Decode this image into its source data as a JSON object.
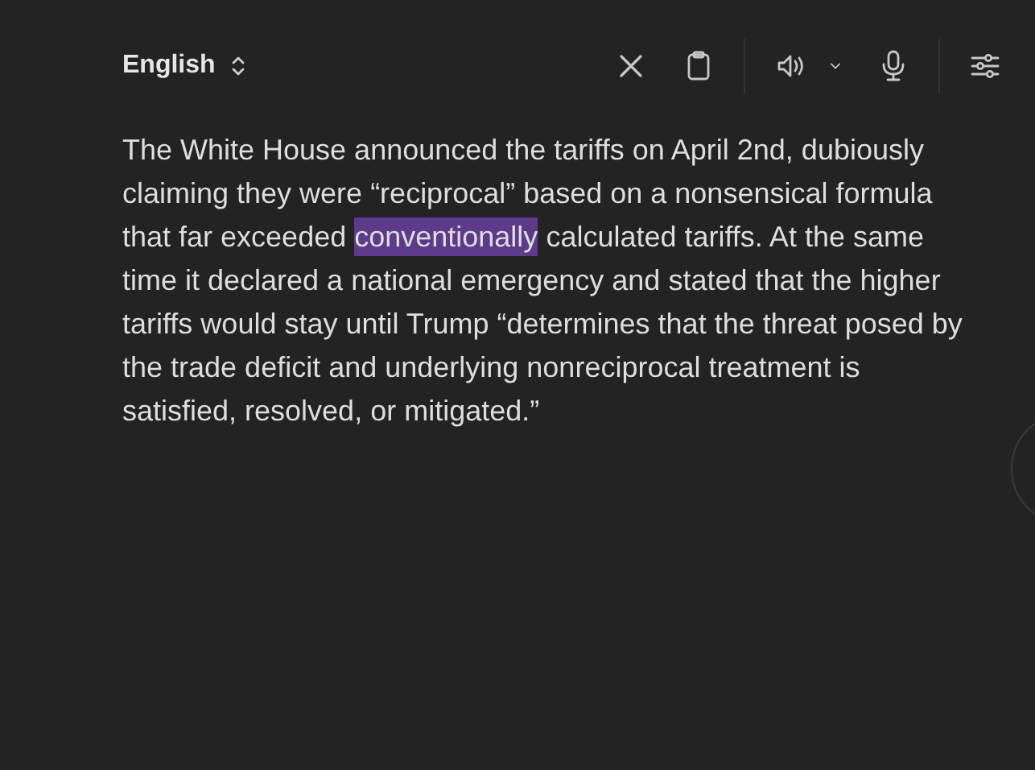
{
  "language_selector": {
    "label": "English"
  },
  "toolbar": [
    {
      "kind": "close"
    },
    {
      "kind": "clipboard"
    },
    {
      "kind": "divider"
    },
    {
      "kind": "speaker"
    },
    {
      "kind": "chevron"
    },
    {
      "kind": "microphone"
    },
    {
      "kind": "divider"
    },
    {
      "kind": "sliders"
    }
  ],
  "passage": [
    {
      "text": "The White House announced the tariffs on April 2nd, dubiously claiming they were “reciprocal” based on a nonsensical formula that far exceeded ",
      "selected": false
    },
    {
      "text": "conventionally",
      "selected": true
    },
    {
      "text": " calculated tariffs. At the same time it declared a national emergency and stated that the higher tariffs would stay until Trump “determines that the threat posed by the trade deficit and underlying nonreciprocal treatment is satisfied, resolved, or mitigated.”",
      "selected": false
    }
  ]
}
